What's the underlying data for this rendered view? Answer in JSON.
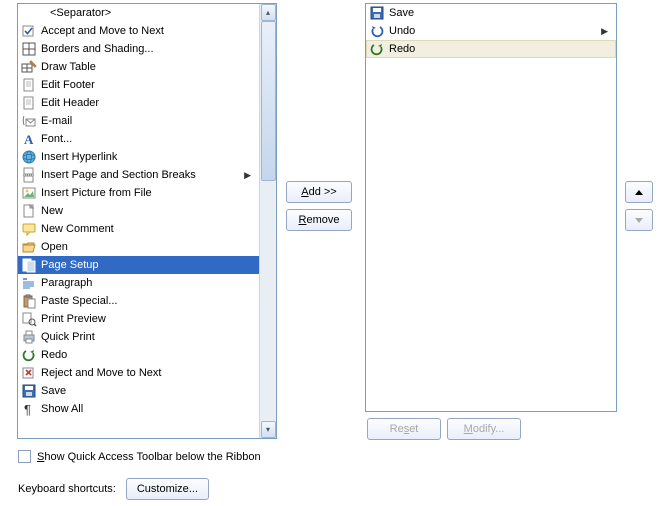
{
  "left": {
    "items": [
      {
        "label": "<Separator>",
        "icon": "none",
        "indent": true
      },
      {
        "label": "Accept and Move to Next",
        "icon": "accept"
      },
      {
        "label": "Borders and Shading...",
        "icon": "borders"
      },
      {
        "label": "Draw Table",
        "icon": "draw-table"
      },
      {
        "label": "Edit Footer",
        "icon": "page"
      },
      {
        "label": "Edit Header",
        "icon": "page"
      },
      {
        "label": "E-mail",
        "icon": "email"
      },
      {
        "label": "Font...",
        "icon": "font"
      },
      {
        "label": "Insert Hyperlink",
        "icon": "hyperlink"
      },
      {
        "label": "Insert Page and Section Breaks",
        "icon": "page-break",
        "submenu": true
      },
      {
        "label": "Insert Picture from File",
        "icon": "picture"
      },
      {
        "label": "New",
        "icon": "new-doc"
      },
      {
        "label": "New Comment",
        "icon": "comment"
      },
      {
        "label": "Open",
        "icon": "open"
      },
      {
        "label": "Page Setup",
        "icon": "page-setup",
        "selected": true
      },
      {
        "label": "Paragraph",
        "icon": "paragraph"
      },
      {
        "label": "Paste Special...",
        "icon": "paste"
      },
      {
        "label": "Print Preview",
        "icon": "print-preview"
      },
      {
        "label": "Quick Print",
        "icon": "print"
      },
      {
        "label": "Redo",
        "icon": "redo"
      },
      {
        "label": "Reject and Move to Next",
        "icon": "reject"
      },
      {
        "label": "Save",
        "icon": "save"
      },
      {
        "label": "Show All",
        "icon": "pilcrow"
      }
    ]
  },
  "right": {
    "items": [
      {
        "label": "Save",
        "icon": "save"
      },
      {
        "label": "Undo",
        "icon": "undo",
        "submenu": true
      },
      {
        "label": "Redo",
        "icon": "redo",
        "highlight": true
      }
    ]
  },
  "buttons": {
    "add": "Add >>",
    "remove": "Remove",
    "reset": "Reset",
    "modify": "Modify...",
    "customize": "Customize..."
  },
  "checkbox_label": "Show Quick Access Toolbar below the Ribbon",
  "checkbox_key_index": 0,
  "kb_label": "Keyboard shortcuts:"
}
